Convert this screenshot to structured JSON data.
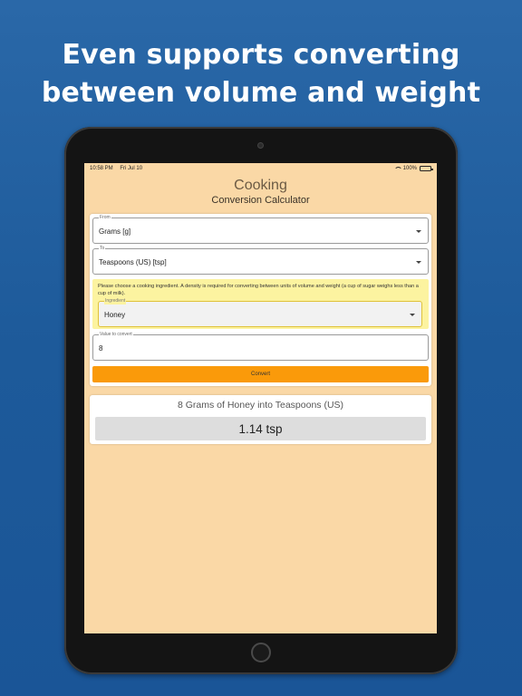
{
  "headline": {
    "line1": "Even supports converting",
    "line2": "between volume and weight"
  },
  "status_bar": {
    "time": "10:58 PM",
    "date": "Fri Jul 10",
    "battery": "100%"
  },
  "app": {
    "title": "Cooking",
    "subtitle": "Conversion Calculator"
  },
  "form": {
    "from": {
      "label": "From",
      "value": "Grams [g]"
    },
    "to": {
      "label": "To",
      "value": "Teaspoons (US) [tsp]"
    },
    "ingredient_note": "Please choose a cooking ingredient. A density is required for converting between units of volume and weight (a cup of sugar weighs less than a cup of milk).",
    "ingredient": {
      "label": "Ingredient",
      "value": "Honey"
    },
    "value_to_convert": {
      "label": "Value to convert",
      "value": "8"
    },
    "convert_label": "Convert"
  },
  "result": {
    "heading": "8 Grams of Honey into Teaspoons (US)",
    "value": "1.14 tsp"
  },
  "colors": {
    "background": "#1f5c9c",
    "screen": "#fad8a6",
    "accent": "#fa9a0a",
    "note_highlight": "#fcf3a0"
  }
}
